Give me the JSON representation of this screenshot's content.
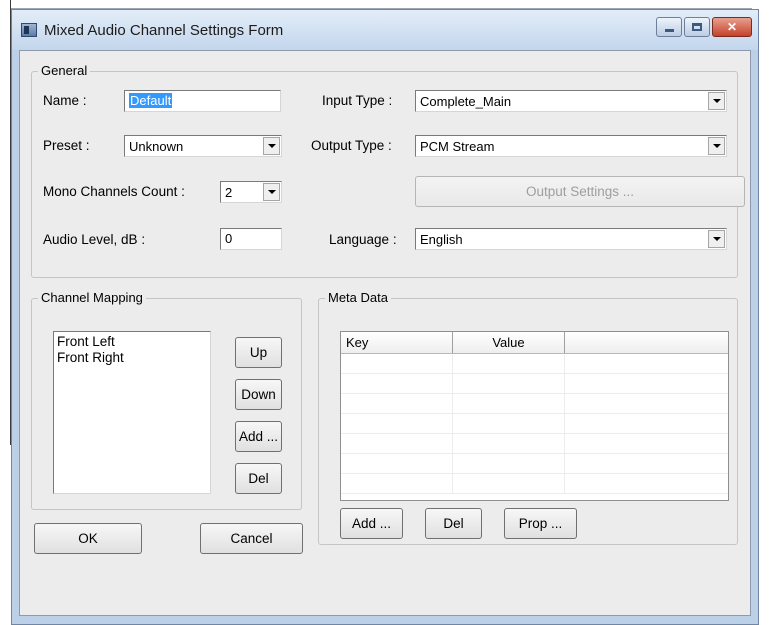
{
  "window": {
    "title": "Mixed Audio Channel Settings Form",
    "minimize_icon": "minimize-icon",
    "maximize_icon": "maximize-icon",
    "close_icon": "close-icon",
    "close_glyph": "✕"
  },
  "general": {
    "legend": "General",
    "name_label": "Name :",
    "name_value": "Default",
    "preset_label": "Preset :",
    "preset_value": "Unknown",
    "mono_label": "Mono Channels Count :",
    "mono_value": "2",
    "audio_label": "Audio Level, dB :",
    "audio_value": "0",
    "input_type_label": "Input Type :",
    "input_type_value": "Complete_Main",
    "output_type_label": "Output Type :",
    "output_type_value": "PCM Stream",
    "output_settings_label": "Output Settings ...",
    "language_label": "Language :",
    "language_value": "English"
  },
  "channel_mapping": {
    "legend": "Channel Mapping",
    "items": [
      "Front Left",
      "Front Right"
    ],
    "up_label": "Up",
    "down_label": "Down",
    "add_label": "Add ...",
    "del_label": "Del"
  },
  "meta_data": {
    "legend": "Meta Data",
    "columns": [
      "Key",
      "Value"
    ],
    "add_label": "Add ...",
    "del_label": "Del",
    "prop_label": "Prop ..."
  },
  "footer": {
    "ok_label": "OK",
    "cancel_label": "Cancel"
  }
}
